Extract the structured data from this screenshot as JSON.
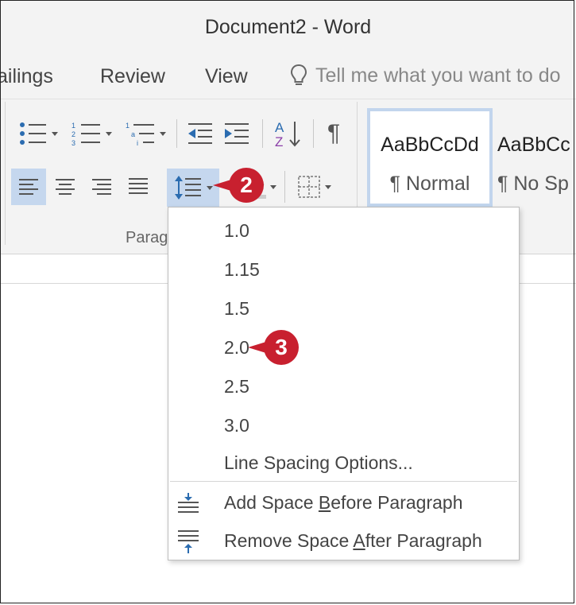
{
  "window": {
    "title": "Document2 - Word"
  },
  "tabs": [
    {
      "label": "ailings"
    },
    {
      "label": "Review"
    },
    {
      "label": "View"
    }
  ],
  "tell_me": {
    "placeholder": "Tell me what you want to do"
  },
  "paragraph_group": {
    "label": "Parag"
  },
  "styles": [
    {
      "sample": "AaBbCcDd",
      "name": "¶ Normal"
    },
    {
      "sample": "AaBbCc",
      "name": "¶ No Sp"
    }
  ],
  "line_spacing_menu": {
    "items": [
      "1.0",
      "1.15",
      "1.5",
      "2.0",
      "2.5",
      "3.0"
    ],
    "options_label": "Line Spacing Options...",
    "add_before": {
      "pre": "Add Space ",
      "u": "B",
      "post": "efore Paragraph"
    },
    "remove_after": {
      "pre": "Remove Space ",
      "u": "A",
      "post": "fter Paragraph"
    }
  },
  "callouts": {
    "step2": "2",
    "step3": "3"
  },
  "colors": {
    "accent": "#c8202f",
    "selected": "#c5d7ee",
    "icon_blue": "#2b6cb0"
  },
  "icons": {
    "sort": "sort-az-icon",
    "pilcrow": "¶",
    "lightbulb": "lightbulb-icon"
  }
}
